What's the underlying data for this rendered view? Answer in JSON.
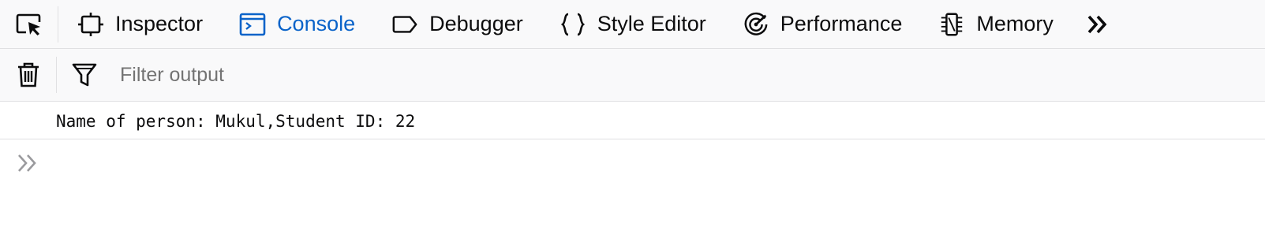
{
  "tabs": [
    {
      "label": "Inspector",
      "icon": "inspector-icon",
      "selected": false
    },
    {
      "label": "Console",
      "icon": "console-icon",
      "selected": true
    },
    {
      "label": "Debugger",
      "icon": "debugger-icon",
      "selected": false
    },
    {
      "label": "Style Editor",
      "icon": "style-editor-icon",
      "selected": false
    },
    {
      "label": "Performance",
      "icon": "performance-icon",
      "selected": false
    },
    {
      "label": "Memory",
      "icon": "memory-icon",
      "selected": false
    }
  ],
  "toolbar": {
    "filter_placeholder": "Filter output"
  },
  "console": {
    "messages": [
      "Name of person: Mukul,Student ID: 22"
    ]
  },
  "colors": {
    "selected_tab": "#0a63c9",
    "toolbar_bg": "#f9f9fa",
    "border": "#e0e0e2"
  }
}
